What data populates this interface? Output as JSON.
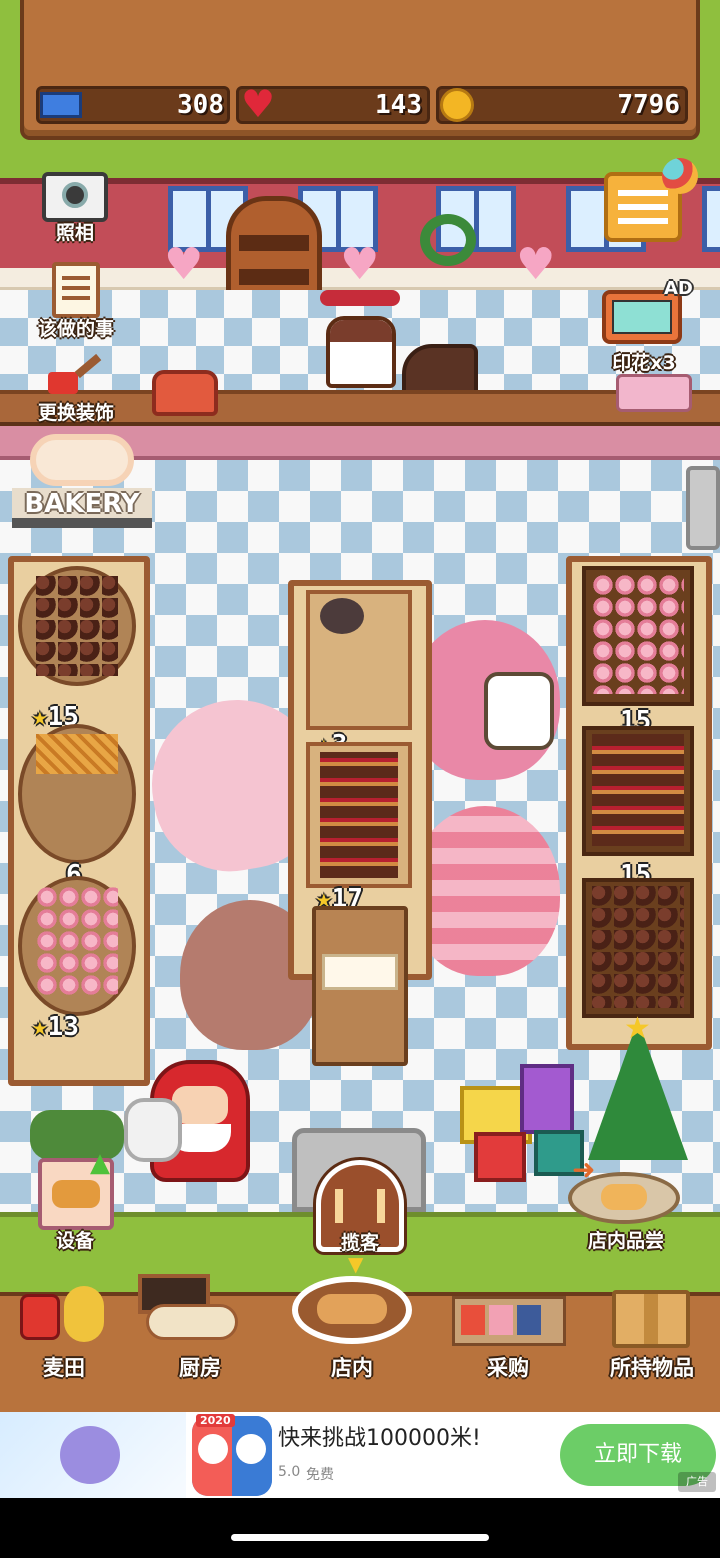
{
  "hud": {
    "tickets": "308",
    "hearts": "143",
    "coins": "7796"
  },
  "side_buttons": {
    "photo": "照相",
    "todo": "该做的事",
    "decorate": "更换装饰",
    "stamp": "印花x3",
    "ad_badge": "AD",
    "equipment": "设备",
    "solicit": "揽客",
    "tasting": "店内品尝"
  },
  "sign": "BAKERY",
  "shelf_badges": {
    "left_1": "15",
    "left_2": "6",
    "left_3": "13",
    "center_1": "3",
    "center_2": "17",
    "right_1": "15",
    "right_2": "15"
  },
  "nav": [
    {
      "label": "麦田"
    },
    {
      "label": "厨房"
    },
    {
      "label": "店内"
    },
    {
      "label": "采购"
    },
    {
      "label": "所持物品"
    }
  ],
  "ad": {
    "badge": "2020",
    "title": "快来挑战100000米!",
    "rating": "5.0",
    "price": "免费",
    "cta": "立即下载",
    "tag": "广告"
  },
  "colors": {
    "grass": "#8fbf3e",
    "wood": "#b8733d",
    "wall": "#c24d58",
    "cta": "#6ccd67"
  }
}
